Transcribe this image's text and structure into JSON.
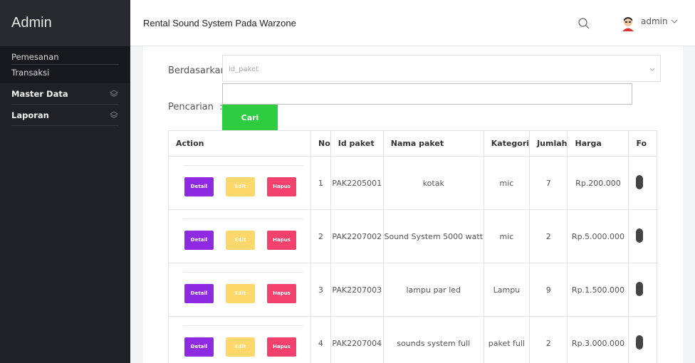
{
  "sidebar": {
    "brand": "Admin",
    "submenu": [
      "Pemesanan",
      "Transaksi"
    ],
    "items": [
      {
        "label": "Master Data",
        "icon": "layers-icon"
      },
      {
        "label": "Laporan",
        "icon": "layers-icon"
      }
    ]
  },
  "topbar": {
    "title": "Rental Sound System Pada Warzone",
    "user": "admin",
    "icons": [
      "search-icon",
      "avatar",
      "chevron-down-icon"
    ]
  },
  "form": {
    "berdasarkan_label": "Berdasarkan",
    "berdasarkan_colon": ":",
    "select_value": "id_paket",
    "pencarian_label": "Pencarian",
    "pencarian_colon": ":",
    "search_value": "",
    "button": "Cari"
  },
  "table": {
    "headers": [
      "Action",
      "No",
      "Id paket",
      "Nama paket",
      "Kategori",
      "Jumlah",
      "Harga",
      "Fo"
    ],
    "action_labels": {
      "detail": "Detail",
      "edit": "Edit",
      "hapus": "Hapus"
    },
    "rows": [
      {
        "no": "1",
        "id": "PAK2205001",
        "nama": "kotak",
        "kategori": "mic",
        "jumlah": "7",
        "harga": "Rp.200.000"
      },
      {
        "no": "2",
        "id": "PAK2207002",
        "nama": "Sound System 5000 watt",
        "kategori": "mic",
        "jumlah": "2",
        "harga": "Rp.5.000.000"
      },
      {
        "no": "3",
        "id": "PAK2207003",
        "nama": "lampu par led",
        "kategori": "Lampu",
        "jumlah": "9",
        "harga": "Rp.1.500.000"
      },
      {
        "no": "4",
        "id": "PAK2207004",
        "nama": "sounds system full",
        "kategori": "paket full",
        "jumlah": "2",
        "harga": "Rp.3.000.000"
      }
    ]
  },
  "colors": {
    "sidebar": "#1f2125",
    "detail": "#8e2be2",
    "edit": "#ffd86b",
    "hapus": "#f1416c",
    "cari": "#2ecc40"
  }
}
